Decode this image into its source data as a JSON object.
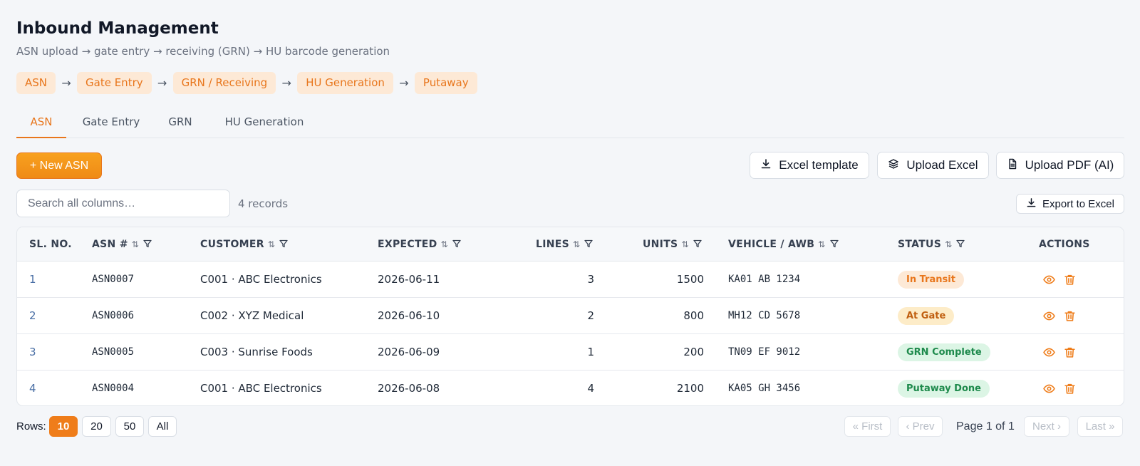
{
  "header": {
    "title": "Inbound Management",
    "subtitle": "ASN upload → gate entry → receiving (GRN) → HU barcode generation"
  },
  "flow": {
    "steps": [
      "ASN",
      "Gate Entry",
      "GRN / Receiving",
      "HU Generation",
      "Putaway"
    ],
    "arrow": "→"
  },
  "tabs": [
    "ASN",
    "Gate Entry",
    "GRN",
    "HU Generation"
  ],
  "active_tab": "ASN",
  "toolbar": {
    "new_asn": "+ New ASN",
    "excel_template": "Excel template",
    "upload_excel": "Upload Excel",
    "upload_pdf": "Upload PDF (AI)"
  },
  "search": {
    "placeholder": "Search all columns…",
    "records": "4 records",
    "export": "Export to Excel"
  },
  "table": {
    "columns": [
      "SL. NO.",
      "ASN #",
      "CUSTOMER",
      "EXPECTED",
      "LINES",
      "UNITS",
      "VEHICLE / AWB",
      "STATUS",
      "ACTIONS"
    ],
    "rows": [
      {
        "sl": "1",
        "asn": "ASN0007",
        "customer": "C001 · ABC Electronics",
        "expected": "2026-06-11",
        "lines": "3",
        "units": "1500",
        "vehicle": "KA01 AB 1234",
        "status": "In Transit"
      },
      {
        "sl": "2",
        "asn": "ASN0006",
        "customer": "C002 · XYZ Medical",
        "expected": "2026-06-10",
        "lines": "2",
        "units": "800",
        "vehicle": "MH12 CD 5678",
        "status": "At Gate"
      },
      {
        "sl": "3",
        "asn": "ASN0005",
        "customer": "C003 · Sunrise Foods",
        "expected": "2026-06-09",
        "lines": "1",
        "units": "200",
        "vehicle": "TN09 EF 9012",
        "status": "GRN Complete"
      },
      {
        "sl": "4",
        "asn": "ASN0004",
        "customer": "C001 · ABC Electronics",
        "expected": "2026-06-08",
        "lines": "4",
        "units": "2100",
        "vehicle": "KA05 GH 3456",
        "status": "Putaway Done"
      }
    ]
  },
  "pagination": {
    "rows_label": "Rows:",
    "row_options": [
      "10",
      "20",
      "50",
      "All"
    ],
    "selected": "10",
    "first": "« First",
    "prev": "‹ Prev",
    "page_info": "Page 1 of 1",
    "next": "Next ›",
    "last": "Last »"
  },
  "colors": {
    "accent": "#ef7d1a",
    "accent_light": "#fde9d6",
    "status_green_bg": "#dcf5e5",
    "status_green_text": "#1e8a4c"
  },
  "icons": {
    "sort": "sort-icon",
    "filter": "filter-icon",
    "view": "eye-icon",
    "delete": "trash-icon",
    "download": "download-icon",
    "layers": "layers-icon",
    "file": "file-icon"
  }
}
